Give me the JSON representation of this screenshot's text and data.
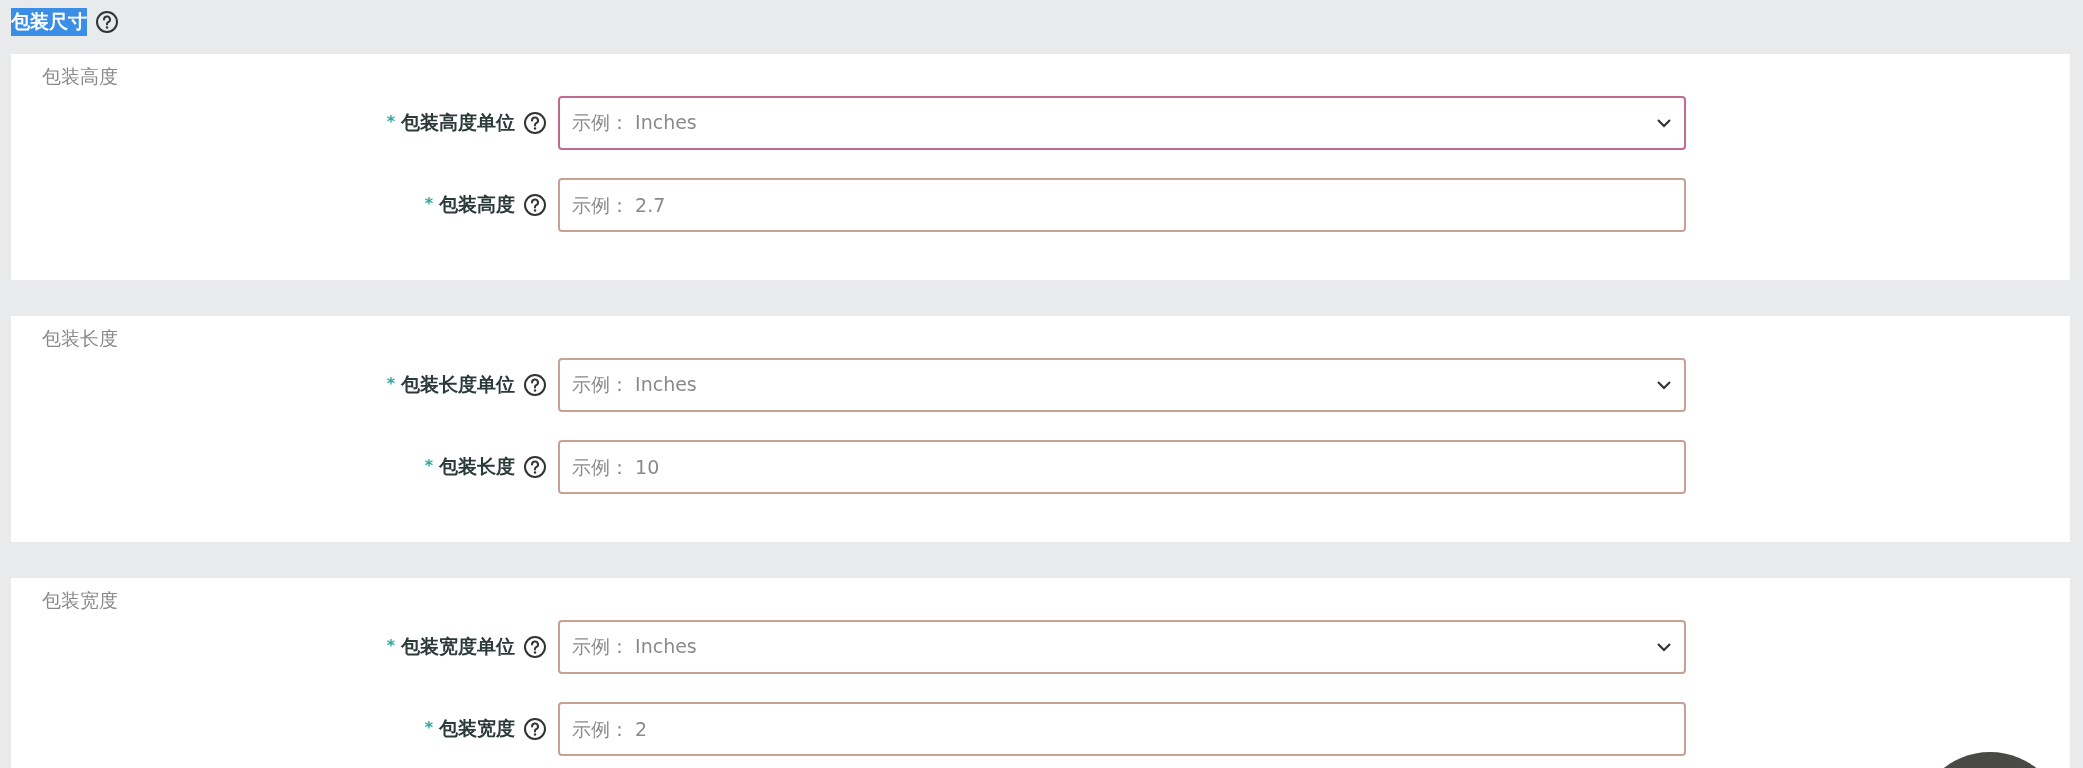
{
  "section": {
    "title": "包装尺寸",
    "highlighted": true
  },
  "groups": [
    {
      "title": "包装高度",
      "fields": [
        {
          "kind": "select",
          "label": "包装高度单位",
          "required": "*",
          "placeholder": "示例： Inches",
          "focused": true
        },
        {
          "kind": "input",
          "label": "包装高度",
          "required": "*",
          "placeholder": "示例： 2.7",
          "focused": false
        }
      ]
    },
    {
      "title": "包装长度",
      "fields": [
        {
          "kind": "select",
          "label": "包装长度单位",
          "required": "*",
          "placeholder": "示例： Inches",
          "focused": false
        },
        {
          "kind": "input",
          "label": "包装长度",
          "required": "*",
          "placeholder": "示例： 10",
          "focused": false
        }
      ]
    },
    {
      "title": "包装宽度",
      "fields": [
        {
          "kind": "select",
          "label": "包装宽度单位",
          "required": "*",
          "placeholder": "示例： Inches",
          "focused": false
        },
        {
          "kind": "input",
          "label": "包装宽度",
          "required": "*",
          "placeholder": "示例： 2",
          "focused": false
        }
      ]
    }
  ]
}
